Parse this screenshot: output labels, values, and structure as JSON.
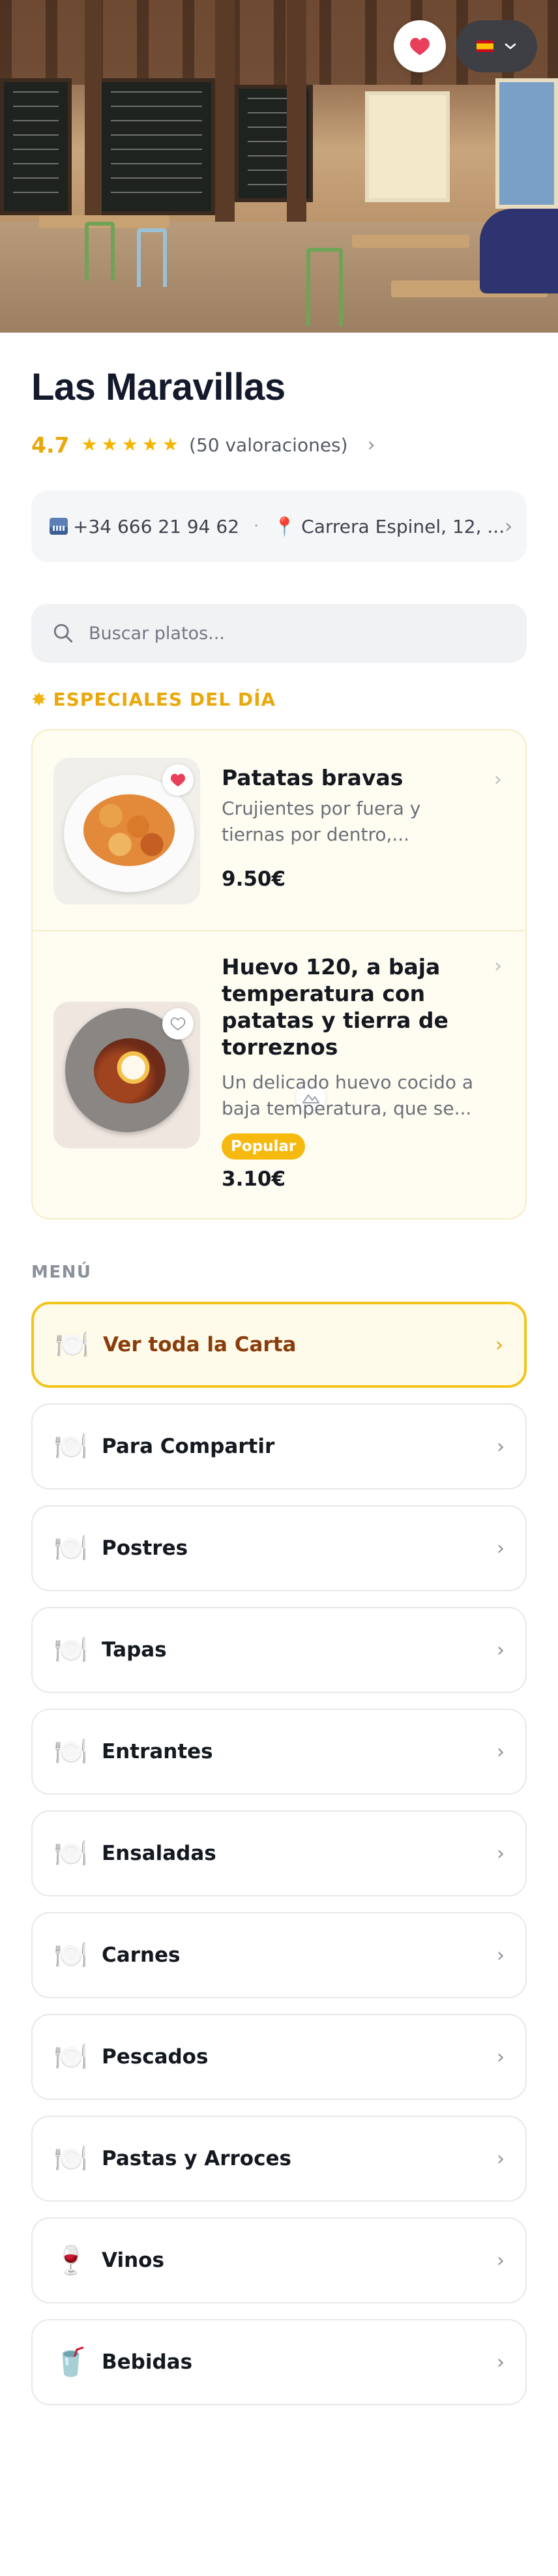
{
  "restaurant": {
    "name": "Las Maravillas",
    "rating": "4.7",
    "rating_count": "(50 valoraciones)",
    "stars": 5
  },
  "language": {
    "flag": "es"
  },
  "contact": {
    "phone": "+34 666 21 94 62",
    "address": "Carrera Espinel, 12, ..."
  },
  "search": {
    "placeholder": "Buscar platos..."
  },
  "specials": {
    "title": "ESPECIALES DEL DÍA",
    "items": [
      {
        "name": "Patatas bravas",
        "description": "Crujientes por fuera y tiernas por dentro,...",
        "price": "9.50€",
        "favorited": true
      },
      {
        "name": "Huevo 120, a baja temperatura con patatas y tierra de torreznos",
        "description": "Un delicado huevo cocido a baja temperatura, que se...",
        "badge": "Popular",
        "price": "3.10€",
        "favorited": false
      }
    ]
  },
  "menu": {
    "title": "MENÚ",
    "items": [
      {
        "label": "Ver toda la Carta",
        "icon": "plate-cutlery-icon",
        "glyph": "🍽️"
      },
      {
        "label": "Para Compartir",
        "icon": "plate-cutlery-icon",
        "glyph": "🍽️"
      },
      {
        "label": "Postres",
        "icon": "plate-cutlery-icon",
        "glyph": "🍽️"
      },
      {
        "label": "Tapas",
        "icon": "plate-cutlery-icon",
        "glyph": "🍽️"
      },
      {
        "label": "Entrantes",
        "icon": "plate-cutlery-icon",
        "glyph": "🍽️"
      },
      {
        "label": "Ensaladas",
        "icon": "plate-cutlery-icon",
        "glyph": "🍽️"
      },
      {
        "label": "Carnes",
        "icon": "plate-cutlery-icon",
        "glyph": "🍽️"
      },
      {
        "label": "Pescados",
        "icon": "plate-cutlery-icon",
        "glyph": "🍽️"
      },
      {
        "label": "Pastas y Arroces",
        "icon": "plate-cutlery-icon",
        "glyph": "🍽️"
      },
      {
        "label": "Vinos",
        "icon": "wine-glass-icon",
        "glyph": "🍷"
      },
      {
        "label": "Bebidas",
        "icon": "cup-straw-icon",
        "glyph": "🥤"
      }
    ]
  },
  "colors": {
    "accent": "#f5b90f",
    "rating": "#e9a809",
    "favorite": "#e8405a",
    "featured_border": "#f3c51b"
  }
}
